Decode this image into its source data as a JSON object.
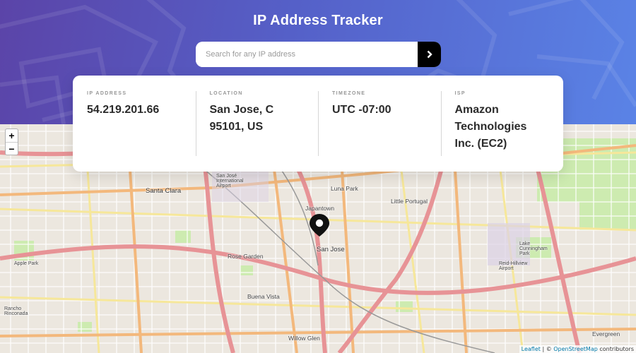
{
  "app": {
    "title": "IP Address Tracker"
  },
  "search": {
    "placeholder": "Search for any IP address",
    "submit_icon": "chevron-right-icon"
  },
  "info": {
    "ip_label": "IP Address",
    "ip_value": "54.219.201.66",
    "location_label": "Location",
    "location_value": "San Jose, C 95101, US",
    "timezone_label": "Timezone",
    "timezone_value": "UTC -07:00",
    "isp_label": "ISP",
    "isp_value": "Amazon Technologies Inc. (EC2)"
  },
  "map": {
    "zoom_in": "+",
    "zoom_out": "−",
    "labels": {
      "santa_clara": "Santa Clara",
      "san_jose": "San Jose",
      "japantown": "Japantown",
      "luna_park": "Luna Park",
      "little_portugal": "Little Portugal",
      "rose_garden": "Rose Garden",
      "buena_vista": "Buena Vista",
      "willow_glen": "Willow Glen",
      "evergreen": "Evergreen",
      "apple_park": "Apple Park",
      "rancho_rinconada": "Rancho Rinconada",
      "lake_cunningham": "Lake Cunningham Park",
      "reid_hillview": "Reid-Hillview Airport",
      "sjc_airport": "San José International Airport"
    },
    "attribution": {
      "leaflet": "Leaflet",
      "separator": " | © ",
      "osm": "OpenStreetMap",
      "suffix": " contributors"
    }
  },
  "colors": {
    "header_start": "#5b44a8",
    "header_end": "#5a83e6",
    "button": "#000000"
  }
}
